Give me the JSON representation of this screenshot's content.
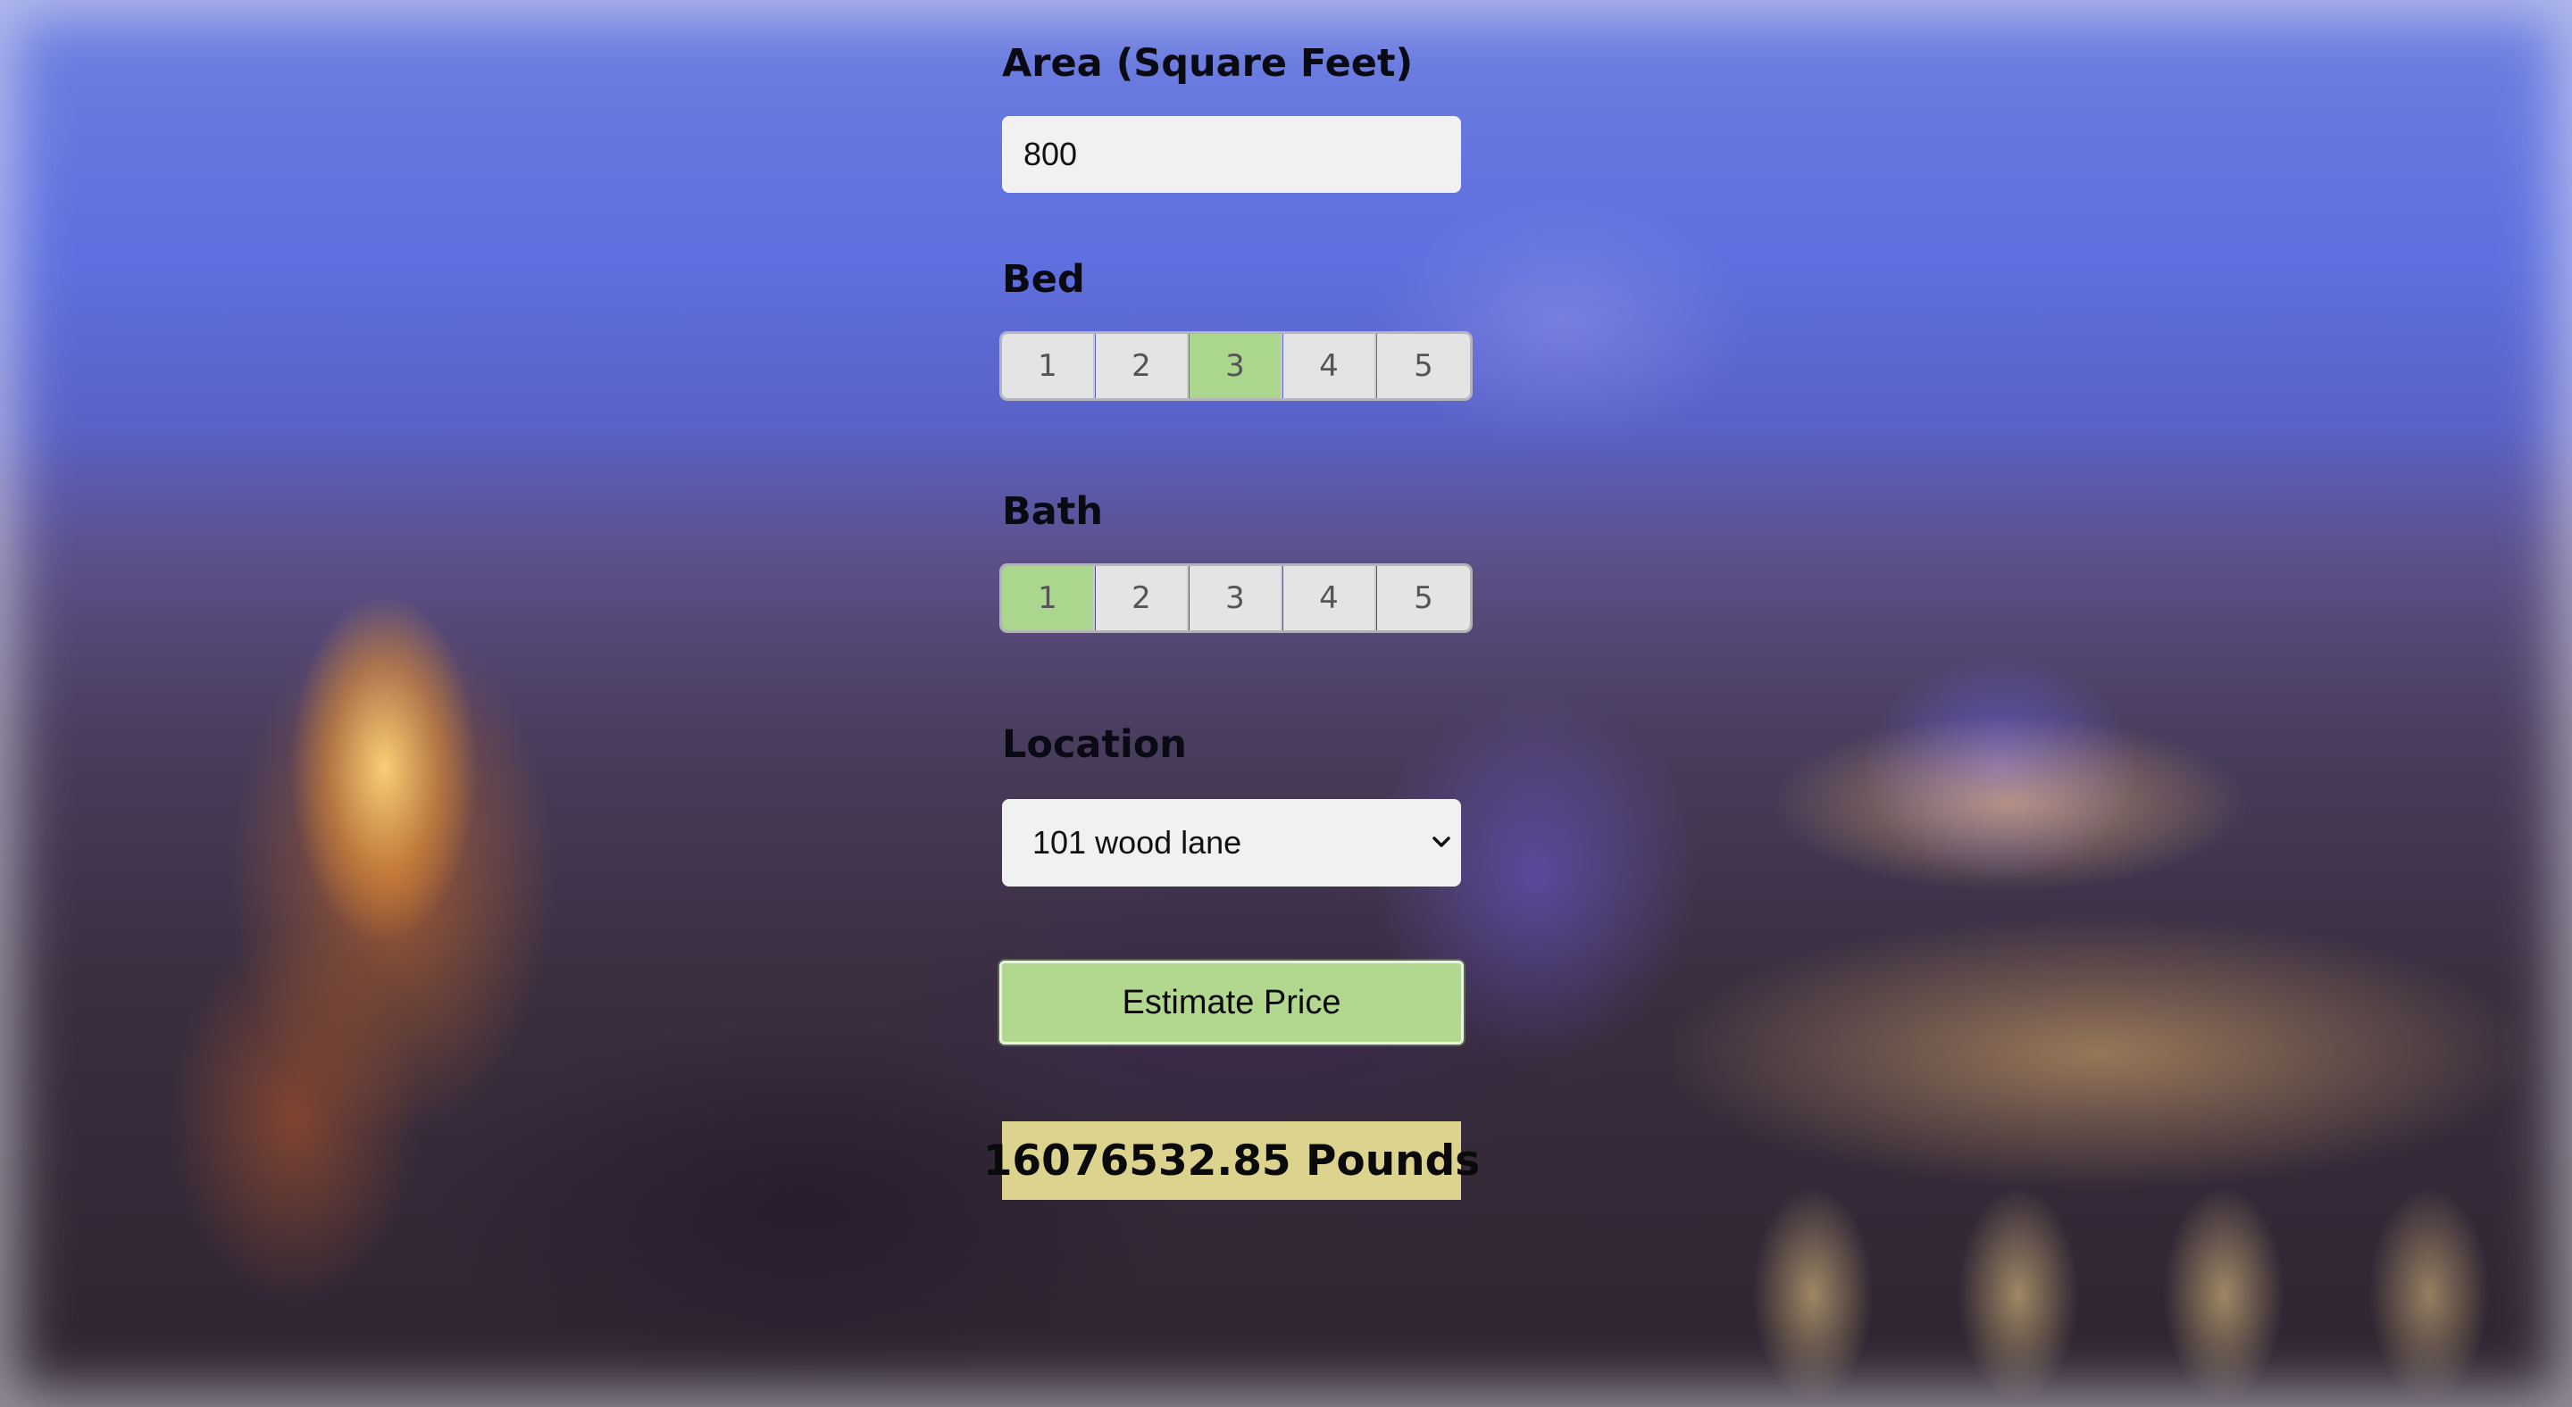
{
  "area": {
    "label": "Area (Square Feet)",
    "value": "800"
  },
  "bed": {
    "label": "Bed",
    "options": [
      "1",
      "2",
      "3",
      "4",
      "5"
    ],
    "selected": "3"
  },
  "bath": {
    "label": "Bath",
    "options": [
      "1",
      "2",
      "3",
      "4",
      "5"
    ],
    "selected": "1"
  },
  "location": {
    "label": "Location",
    "selected": "101 wood lane"
  },
  "estimate_button": {
    "label": "Estimate Price"
  },
  "result": {
    "text": "16076532.85 Pounds"
  },
  "colors": {
    "selected_segment": "#abd68e",
    "button": "#b2d88f",
    "result_background": "#dcd48e"
  },
  "icons": {
    "location_dropdown": "chevron-down-icon"
  }
}
